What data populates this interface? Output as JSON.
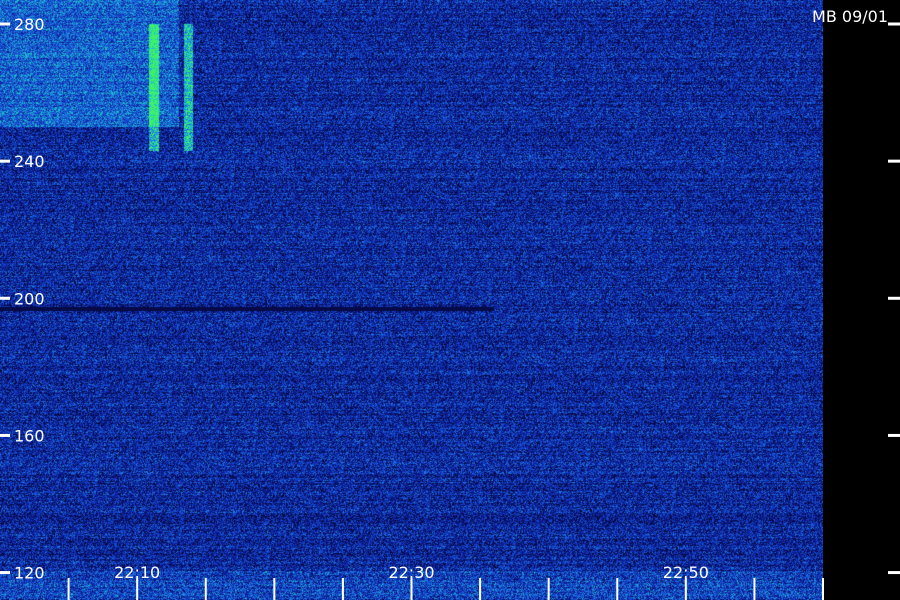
{
  "chart_data": {
    "type": "heatmap",
    "title": "MB 09/01",
    "xlabel": "",
    "ylabel": "",
    "x_range_minutes": [
      2160,
      2220
    ],
    "ylim": [
      112,
      287
    ],
    "x_tick_labels": [
      "22:10",
      "22:30",
      "22:50"
    ],
    "x_tick_values": [
      2170,
      2190,
      2210
    ],
    "y_tick_values": [
      120,
      160,
      200,
      240,
      280
    ],
    "y_tick_labels": [
      "120",
      "160",
      "200",
      "240",
      "280"
    ],
    "minor_x_tick_values": [
      2165,
      2170,
      2175,
      2180,
      2185,
      2190,
      2195,
      2200,
      2205,
      2210,
      2215,
      2220
    ],
    "grid": false,
    "colors": {
      "background": "#000000",
      "low": "#0a1a8a",
      "mid": "#1e64c8",
      "high": "#19c8c8",
      "peak": "#3cff5a",
      "text": "#ffffff"
    },
    "features": [
      {
        "kind": "band",
        "y_from": 250,
        "y_to": 287,
        "x_from": 2160,
        "x_to": 2173,
        "intensity": "high"
      },
      {
        "kind": "streak",
        "x": 2171.2,
        "y_from": 243,
        "y_to": 280,
        "intensity": "peak"
      },
      {
        "kind": "streak",
        "x": 2173.7,
        "y_from": 243,
        "y_to": 280,
        "intensity": "peak"
      },
      {
        "kind": "dark_line",
        "y": 197,
        "x_from": 2160,
        "x_to": 2196
      }
    ]
  }
}
